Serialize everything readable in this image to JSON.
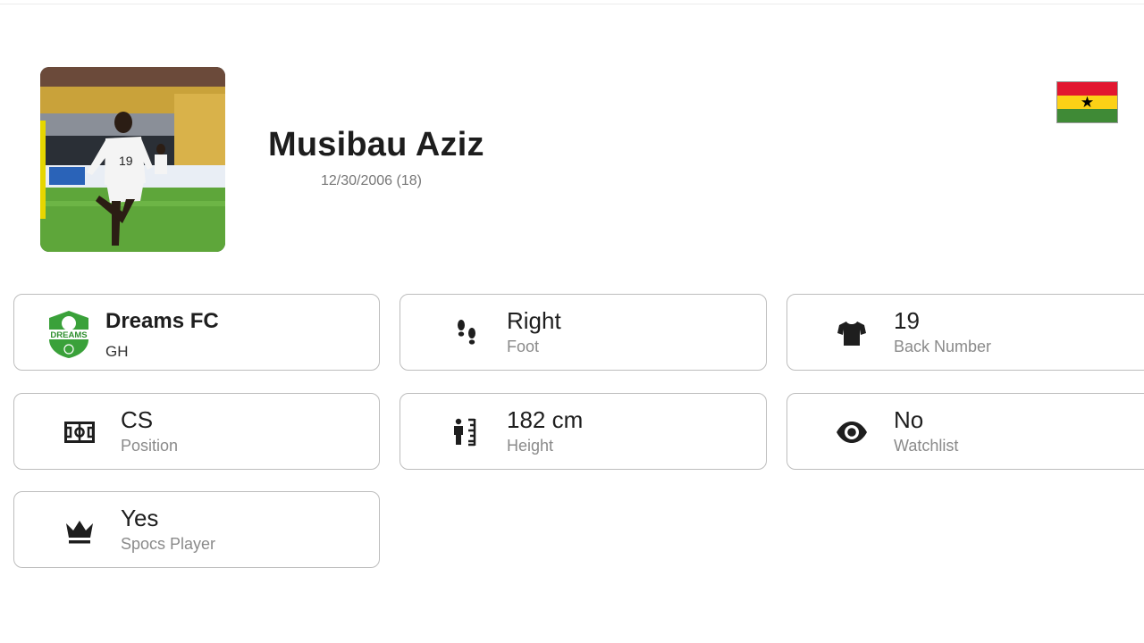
{
  "player": {
    "name": "Musibau Aziz",
    "dob": "12/30/2006 (18)",
    "photo_alt": "player-photo",
    "flag": {
      "country": "Ghana",
      "colors": [
        "#e2162f",
        "#fcd116",
        "#3f8a36"
      ],
      "star_color": "#000000"
    }
  },
  "cards": {
    "club": {
      "value": "Dreams FC",
      "label": "GH",
      "logo_text": "DREAMS",
      "logo_color": "#3aa13a"
    },
    "foot": {
      "value": "Right",
      "label": "Foot",
      "icon": "footprints-icon"
    },
    "number": {
      "value": "19",
      "label": "Back Number",
      "icon": "shirt-icon"
    },
    "position": {
      "value": "CS",
      "label": "Position",
      "icon": "pitch-icon"
    },
    "height": {
      "value": "182 cm",
      "label": "Height",
      "icon": "height-icon"
    },
    "watchlist": {
      "value": "No",
      "label": "Watchlist",
      "icon": "eye-icon"
    },
    "spocs": {
      "value": "Yes",
      "label": "Spocs Player",
      "icon": "crown-icon"
    }
  }
}
